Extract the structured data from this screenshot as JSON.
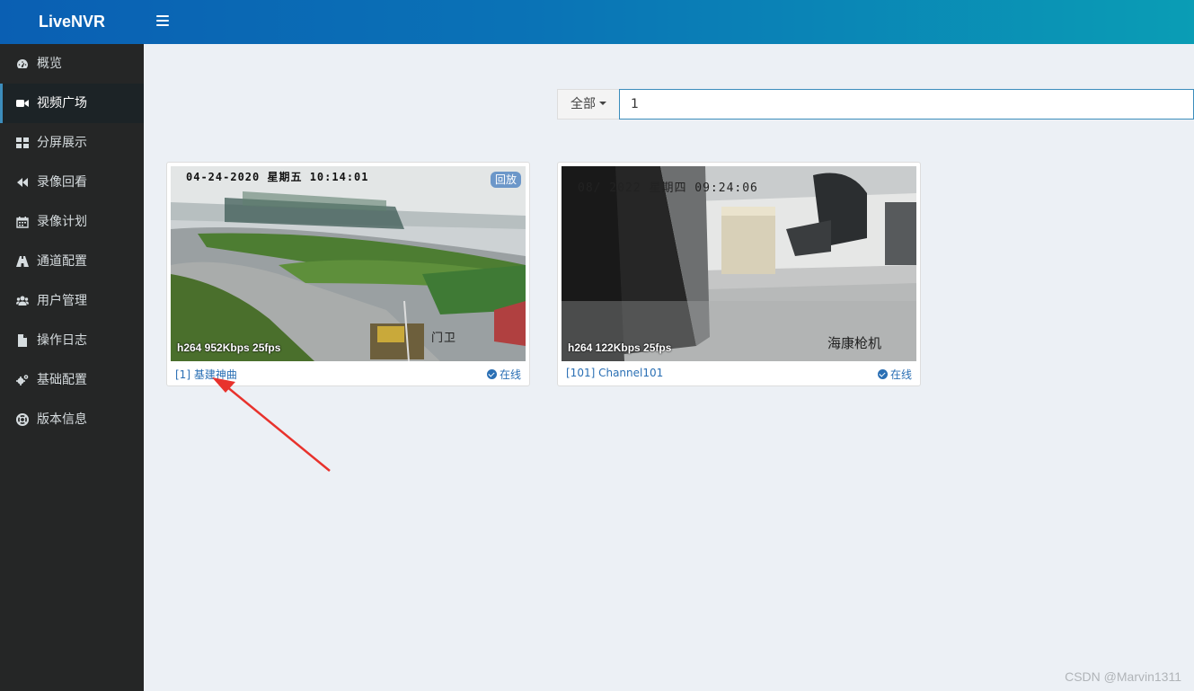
{
  "app": {
    "title": "LiveNVR"
  },
  "sidebar": {
    "items": [
      {
        "label": "概览",
        "icon": "dashboard-icon"
      },
      {
        "label": "视频广场",
        "icon": "video-camera-icon",
        "active": true
      },
      {
        "label": "分屏展示",
        "icon": "grid-icon"
      },
      {
        "label": "录像回看",
        "icon": "backward-icon"
      },
      {
        "label": "录像计划",
        "icon": "calendar-icon"
      },
      {
        "label": "通道配置",
        "icon": "road-icon"
      },
      {
        "label": "用户管理",
        "icon": "users-icon"
      },
      {
        "label": "操作日志",
        "icon": "file-icon"
      },
      {
        "label": "基础配置",
        "icon": "gears-icon"
      },
      {
        "label": "版本信息",
        "icon": "lifebuoy-icon"
      }
    ]
  },
  "filter": {
    "selected": "全部",
    "search_value": "1"
  },
  "channels": [
    {
      "name": "[1] 基建神曲",
      "stats": "h264 952Kbps 25fps",
      "osd_time": "04-24-2020 星期五 10:14:01",
      "osd_label": "门卫",
      "badge": "回放",
      "status": "在线"
    },
    {
      "name": "[101] Channel101",
      "stats": "h264 122Kbps 25fps",
      "osd_time": "08/  2022 星期四 09:24:06",
      "osd_label": "海康枪机",
      "status": "在线"
    }
  ],
  "watermark": "CSDN @Marvin1311",
  "colors": {
    "accent": "#3c8dbc",
    "sidebar_bg": "#252626",
    "annotation_arrow": "#e8322c"
  }
}
